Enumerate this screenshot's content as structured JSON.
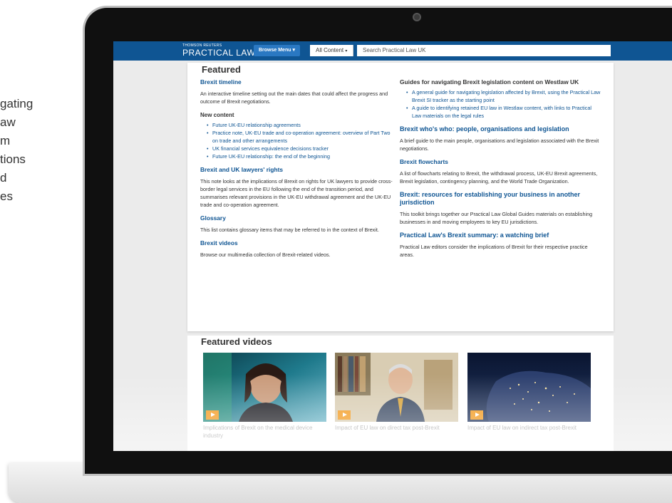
{
  "side_text": [
    "gating",
    "aw",
    "m",
    "tions",
    "d",
    "es"
  ],
  "app": {
    "logo_small": "THOMSON REUTERS",
    "logo_big": "PRACTICAL LAW",
    "browse_label": "Browse Menu",
    "content_label": "All Content",
    "search_placeholder": "Search Practical Law UK"
  },
  "featured": {
    "heading": "Featured",
    "left": {
      "timeline": {
        "title": "Brexit timeline",
        "desc": "An interactive timeline setting out the main dates that could affect the progress and outcome of Brexit negotiations."
      },
      "new_content": {
        "title": "New content",
        "items": [
          "Future UK-EU relationship agreements",
          "Practice note, UK-EU trade and co-operation agreement: overview of Part Two on trade and other arrangements",
          "UK financial services equivalence decisions tracker",
          "Future UK-EU relationship: the end of the beginning"
        ]
      },
      "lawyers": {
        "title": "Brexit and UK lawyers' rights",
        "desc": "This note looks at the implications of Brexit on rights for UK lawyers to provide cross-border legal services in the EU following the end of the transition period, and summarises relevant provisions in the UK-EU withdrawal agreement and the UK-EU trade and co-operation agreement."
      },
      "glossary": {
        "title": "Glossary",
        "desc": "This list contains glossary items that may be referred to in the context of Brexit."
      },
      "videos": {
        "title": "Brexit videos",
        "desc": "Browse our multimedia collection of Brexit-related videos."
      }
    },
    "right": {
      "guides": {
        "title": "Guides for navigating Brexit legislation content on Westlaw UK",
        "items": [
          "A general guide for navigating legislation affected by Brexit, using the Practical Law Brexit SI tracker as the starting point",
          "A guide to identifying retained EU law in Westlaw content, with links to Practical Law materials on the legal rules"
        ]
      },
      "whos_who": {
        "title": "Brexit who's who: people, organisations and legislation",
        "desc": "A brief guide to the main people, organisations and legislation associated with the Brexit negotiations."
      },
      "flowcharts": {
        "title": "Brexit flowcharts",
        "desc": "A list of flowcharts relating to Brexit, the withdrawal process, UK-EU Brexit agreements, Brexit legislation, contingency planning, and the World Trade Organization."
      },
      "resources": {
        "title": "Brexit: resources for establishing your business in another jurisdiction",
        "desc": "This toolkit brings together our Practical Law Global Guides materials on establishing businesses in and moving employees to key EU jurisdictions."
      },
      "summary": {
        "title": "Practical Law's Brexit summary: a watching brief",
        "desc": "Practical Law editors consider the implications of Brexit for their respective practice areas."
      }
    }
  },
  "featured_videos": {
    "heading": "Featured videos",
    "items": [
      {
        "caption": "Implications of Brexit on the medical device industry"
      },
      {
        "caption": "Impact of EU law on direct tax post-Brexit"
      },
      {
        "caption": "Impact of EU law on indirect tax post-Brexit"
      }
    ]
  },
  "colors": {
    "brand_blue": "#0f5593",
    "play_orange": "#f39a1e"
  }
}
